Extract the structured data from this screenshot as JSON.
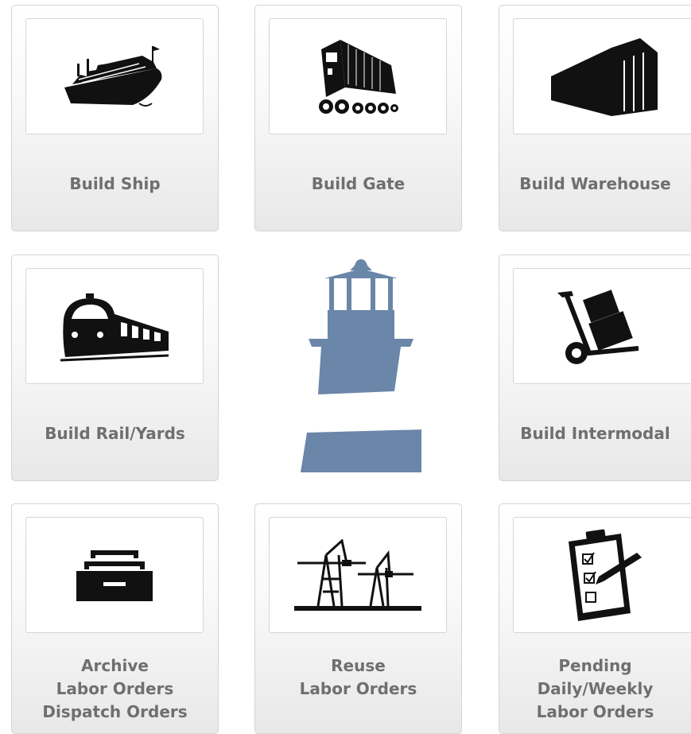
{
  "tiles": {
    "ship": {
      "label": "Build Ship",
      "icon": "ship-icon"
    },
    "gate": {
      "label": "Build Gate",
      "icon": "truck-icon"
    },
    "warehouse": {
      "label": "Build Warehouse",
      "icon": "warehouse-icon"
    },
    "rail": {
      "label": "Build Rail/Yards",
      "icon": "train-icon"
    },
    "intermodal": {
      "label": "Build Intermodal",
      "icon": "hand-truck-icon"
    },
    "archive": {
      "lines": [
        "Archive",
        "Labor Orders",
        "Dispatch Orders"
      ],
      "icon": "file-drawer-icon"
    },
    "reuse": {
      "lines": [
        "Reuse",
        "Labor Orders"
      ],
      "icon": "port-cranes-icon"
    },
    "pending": {
      "lines": [
        "Pending",
        "Daily/Weekly",
        "Labor Orders"
      ],
      "icon": "clipboard-checklist-icon"
    }
  },
  "logo": {
    "icon": "lighthouse-logo",
    "color": "#6a86a8"
  },
  "colors": {
    "label": "#6f6f6f",
    "icon": "#111111"
  }
}
